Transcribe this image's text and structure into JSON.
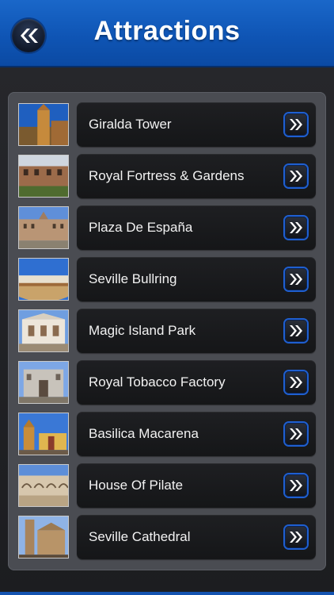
{
  "header": {
    "title": "Attractions",
    "back_icon": "double-chevron-left-icon"
  },
  "colors": {
    "header_blue": "#1158bb",
    "button_ring": "#1f5fd0",
    "panel": "#4a4c52",
    "bar": "#1a1b1e"
  },
  "attractions": [
    {
      "label": "Giralda Tower",
      "thumb": "tower"
    },
    {
      "label": "Royal Fortress & Gardens",
      "thumb": "fortress"
    },
    {
      "label": "Plaza De España",
      "thumb": "plaza"
    },
    {
      "label": "Seville Bullring",
      "thumb": "bullring"
    },
    {
      "label": "Magic Island Park",
      "thumb": "park"
    },
    {
      "label": "Royal Tobacco Factory",
      "thumb": "factory"
    },
    {
      "label": "Basilica Macarena",
      "thumb": "basilica"
    },
    {
      "label": "House Of Pilate",
      "thumb": "pilate"
    },
    {
      "label": "Seville Cathedral",
      "thumb": "cathedral"
    }
  ]
}
